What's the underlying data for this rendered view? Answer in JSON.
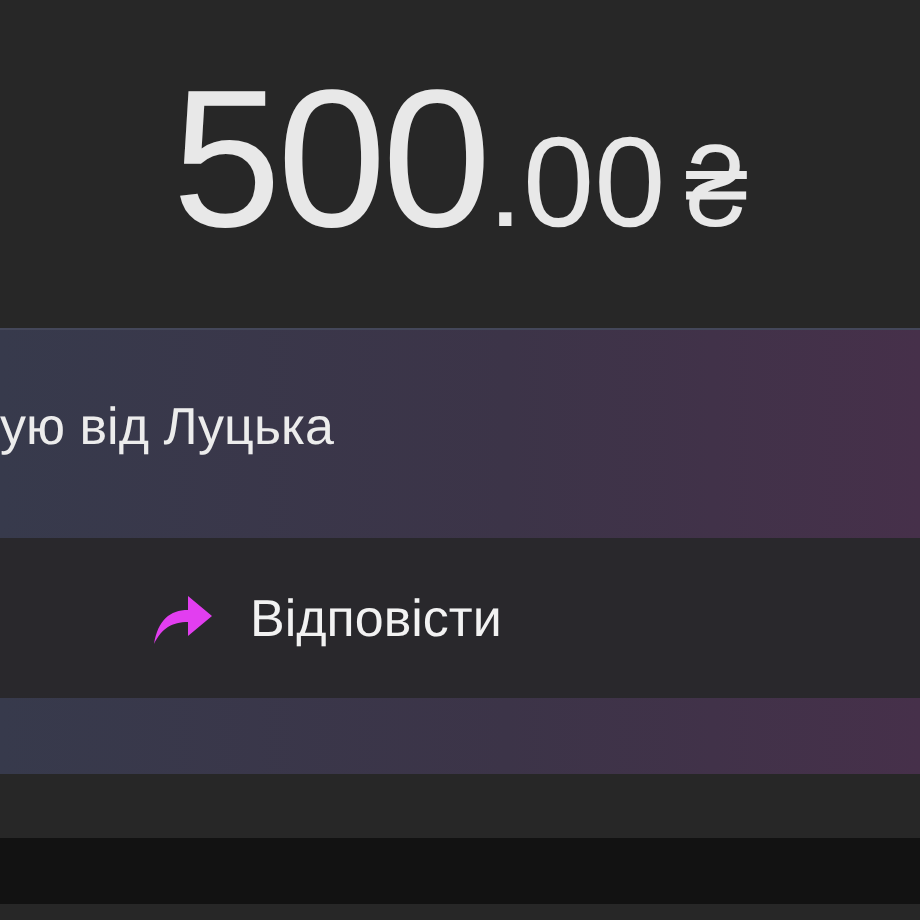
{
  "amount": {
    "whole": "500",
    "fraction": ".00",
    "currency": "₴"
  },
  "message": {
    "text": "ую від Луцька"
  },
  "reply_button": {
    "label": "Відповісти"
  }
}
